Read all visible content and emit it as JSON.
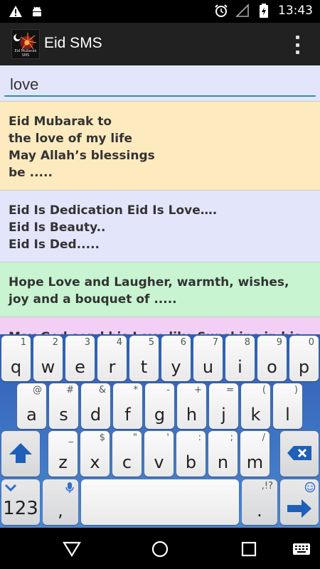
{
  "status_bar": {
    "time": "13:43",
    "left_icons": [
      "warning-icon",
      "android-debug-icon"
    ],
    "right_icons": [
      "alarm-icon",
      "signal-icon",
      "battery-charging-icon"
    ]
  },
  "app": {
    "title": "Eid SMS",
    "logo_text": "Eid Mubarak SMS"
  },
  "search": {
    "value": "love",
    "placeholder": ""
  },
  "sms_list": [
    {
      "text": "Eid Mubarak to\nthe love of my life\nMay Allah’s blessings\nbe .....",
      "bg": "#fdebbf"
    },
    {
      "text": "Eid Is Dedication Eid Is Love….\nEid Is Beauty..\nEid Is Ded.....",
      "bg": "#e3e6fb"
    },
    {
      "text": "Hope Love and Laugher, warmth, wishes,\njoy and a bouquet of .....",
      "bg": "#c8f4d1"
    },
    {
      "text": "May God send his Love like Sunshine in his",
      "bg": "#f3cff5"
    }
  ],
  "keyboard": {
    "row1": [
      {
        "k": "q",
        "s": "1"
      },
      {
        "k": "w",
        "s": "2"
      },
      {
        "k": "e",
        "s": "3"
      },
      {
        "k": "r",
        "s": "4"
      },
      {
        "k": "t",
        "s": "5"
      },
      {
        "k": "y",
        "s": "6"
      },
      {
        "k": "u",
        "s": "7"
      },
      {
        "k": "i",
        "s": "8"
      },
      {
        "k": "o",
        "s": "9"
      },
      {
        "k": "p",
        "s": "0"
      }
    ],
    "row2": [
      {
        "k": "a",
        "s": "@"
      },
      {
        "k": "s",
        "s": "#"
      },
      {
        "k": "d",
        "s": "&"
      },
      {
        "k": "f",
        "s": "*"
      },
      {
        "k": "g",
        "s": "-"
      },
      {
        "k": "h",
        "s": "+"
      },
      {
        "k": "j",
        "s": "="
      },
      {
        "k": "k",
        "s": "("
      },
      {
        "k": "l",
        "s": ")"
      }
    ],
    "row3": [
      {
        "k": "z",
        "s": "_"
      },
      {
        "k": "x",
        "s": "$"
      },
      {
        "k": "c",
        "s": "\""
      },
      {
        "k": "v",
        "s": "'"
      },
      {
        "k": "b",
        "s": ":"
      },
      {
        "k": "n",
        "s": ";"
      },
      {
        "k": "m",
        "s": "/"
      }
    ],
    "numbers_label": "123",
    "comma_label": ",",
    "period_label": ".",
    "period_sub": ",!?",
    "icons": {
      "shift": "shift-arrow-icon",
      "delete": "backspace-icon",
      "mic": "microphone-icon",
      "swiftkey": "swiftkey-logo-icon",
      "enter": "enter-arrow-icon",
      "emoji": "emoji-icon"
    },
    "accent_color": "#1f5fb8"
  },
  "nav_bar": {
    "icons": [
      "back-triangle-icon",
      "home-circle-icon",
      "recents-square-icon",
      "keyboard-switch-icon"
    ]
  }
}
